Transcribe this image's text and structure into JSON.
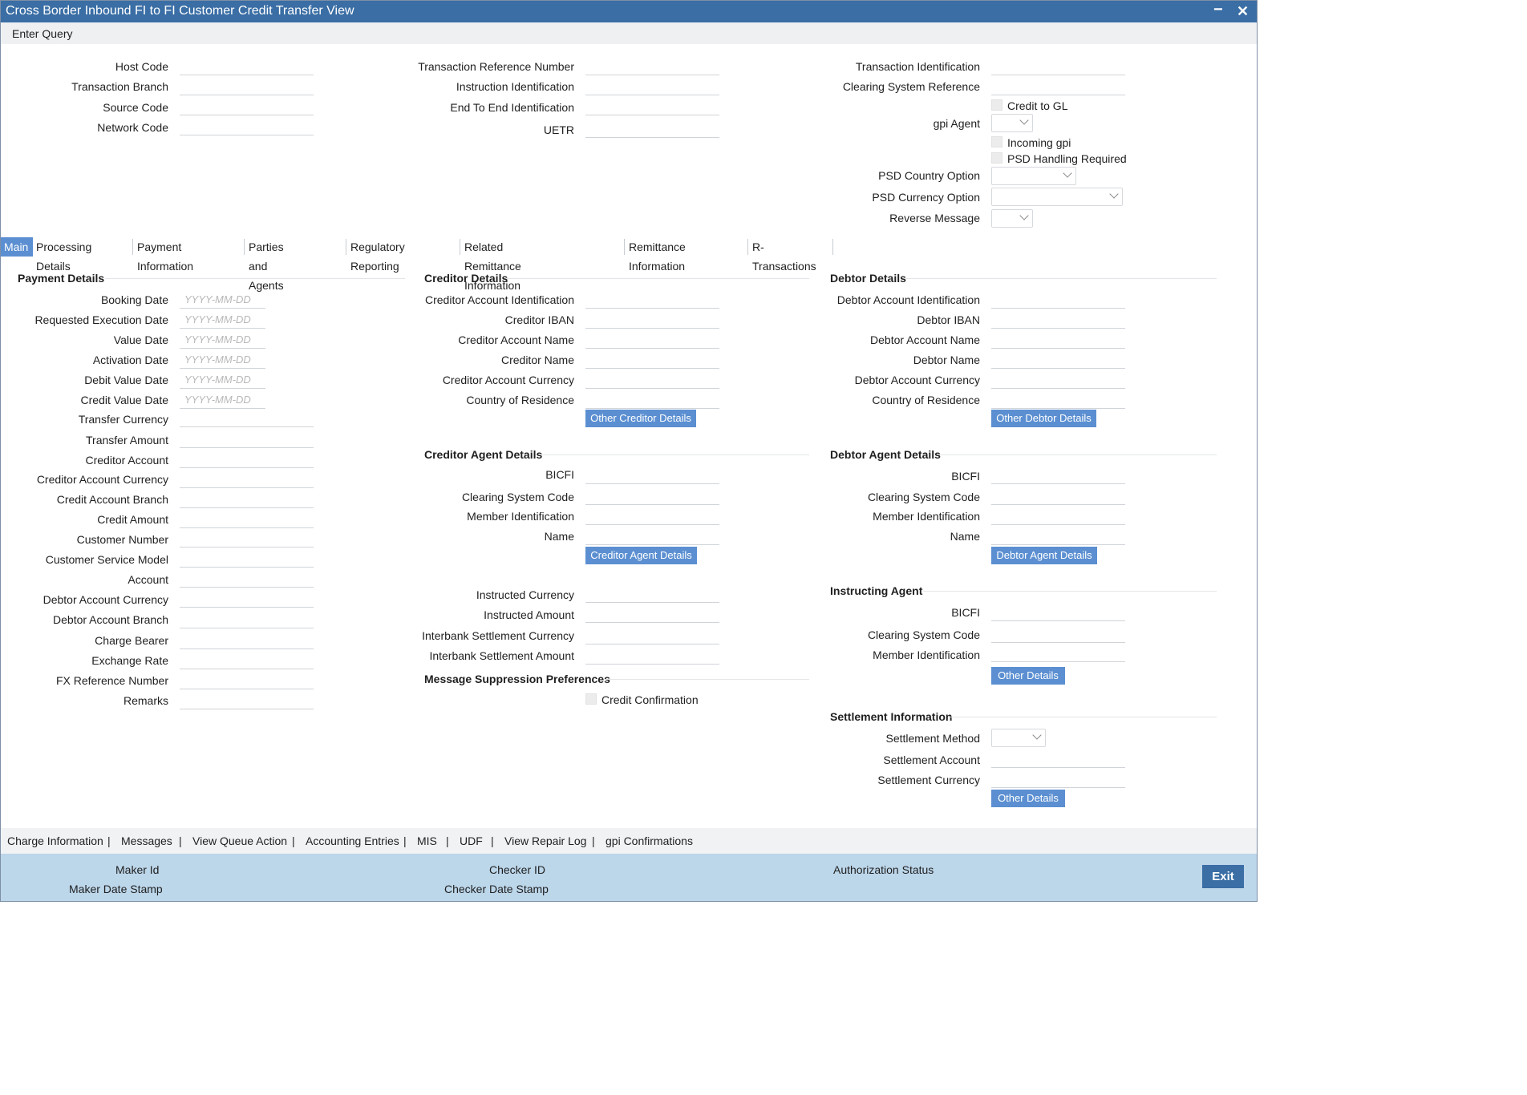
{
  "window": {
    "title": "Cross Border Inbound FI to FI Customer Credit Transfer View",
    "minimize": "−",
    "close": "✕"
  },
  "toolbar": {
    "enter_query": "Enter Query"
  },
  "header": {
    "host_code": "Host Code",
    "transaction_branch": "Transaction Branch",
    "source_code": "Source Code",
    "network_code": "Network Code",
    "transaction_reference_number": "Transaction Reference Number",
    "instruction_identification": "Instruction Identification",
    "end_to_end_identification": "End To End Identification",
    "uetr": "UETR",
    "transaction_identification": "Transaction Identification",
    "clearing_system_reference": "Clearing System Reference",
    "credit_to_gl": "Credit to GL",
    "gpi_agent": "gpi Agent",
    "incoming_gpi": "Incoming gpi",
    "psd_handling_required": "PSD Handling Required",
    "psd_country_option": "PSD Country Option",
    "psd_currency_option": "PSD Currency Option",
    "reverse_message": "Reverse Message"
  },
  "tabs": [
    "Main",
    "Processing Details",
    "Payment Information",
    "Parties and Agents",
    "Regulatory Reporting",
    "Related Remittance Information",
    "Remittance Information",
    "R-Transactions"
  ],
  "payment_details": {
    "title": "Payment Details",
    "date_placeholder": "YYYY-MM-DD",
    "booking_date": "Booking Date",
    "requested_execution_date": "Requested Execution Date",
    "value_date": "Value Date",
    "activation_date": "Activation Date",
    "debit_value_date": "Debit Value Date",
    "credit_value_date": "Credit Value Date",
    "transfer_currency": "Transfer Currency",
    "transfer_amount": "Transfer Amount",
    "creditor_account": "Creditor Account",
    "creditor_account_currency": "Creditor Account Currency",
    "credit_account_branch": "Credit Account Branch",
    "credit_amount": "Credit Amount",
    "customer_number": "Customer Number",
    "customer_service_model": "Customer Service Model",
    "account": "Account",
    "debtor_account_currency": "Debtor Account Currency",
    "debtor_account_branch": "Debtor Account Branch",
    "charge_bearer": "Charge Bearer",
    "exchange_rate": "Exchange Rate",
    "fx_reference_number": "FX Reference Number",
    "remarks": "Remarks"
  },
  "creditor_details": {
    "title": "Creditor Details",
    "account_identification": "Creditor Account Identification",
    "iban": "Creditor IBAN",
    "account_name": "Creditor Account Name",
    "name": "Creditor Name",
    "account_currency": "Creditor Account Currency",
    "country_of_residence": "Country of Residence",
    "other_button": "Other Creditor Details"
  },
  "creditor_agent": {
    "title": "Creditor Agent Details",
    "bicfi": "BICFI",
    "clearing_system_code": "Clearing System Code",
    "member_identification": "Member Identification",
    "name": "Name",
    "button": "Creditor Agent Details"
  },
  "amounts": {
    "instructed_currency": "Instructed Currency",
    "instructed_amount": "Instructed Amount",
    "interbank_settlement_currency": "Interbank Settlement Currency",
    "interbank_settlement_amount": "Interbank Settlement Amount"
  },
  "message_suppression": {
    "title": "Message Suppression Preferences",
    "credit_confirmation": "Credit Confirmation"
  },
  "debtor_details": {
    "title": "Debtor Details",
    "account_identification": "Debtor Account Identification",
    "iban": "Debtor IBAN",
    "account_name": "Debtor Account Name",
    "name": "Debtor Name",
    "account_currency": "Debtor Account Currency",
    "country_of_residence": "Country of Residence",
    "other_button": "Other Debtor Details"
  },
  "debtor_agent": {
    "title": "Debtor Agent Details",
    "bicfi": "BICFI",
    "clearing_system_code": "Clearing System Code",
    "member_identification": "Member Identification",
    "name": "Name",
    "button": "Debtor Agent Details"
  },
  "instructing_agent": {
    "title": "Instructing Agent",
    "bicfi": "BICFI",
    "clearing_system_code": "Clearing System Code",
    "member_identification": "Member Identification",
    "button": "Other Details"
  },
  "settlement": {
    "title": "Settlement Information",
    "method": "Settlement Method",
    "account": "Settlement Account",
    "currency": "Settlement Currency",
    "button": "Other Details"
  },
  "bottom_links": [
    "Charge Information",
    "Messages",
    "View Queue Action",
    "Accounting Entries",
    "MIS",
    "UDF",
    "View Repair Log",
    "gpi Confirmations"
  ],
  "footer": {
    "maker_id": "Maker Id",
    "maker_date_stamp": "Maker Date Stamp",
    "checker_id": "Checker ID",
    "checker_date_stamp": "Checker Date Stamp",
    "authorization_status": "Authorization Status",
    "exit": "Exit"
  }
}
